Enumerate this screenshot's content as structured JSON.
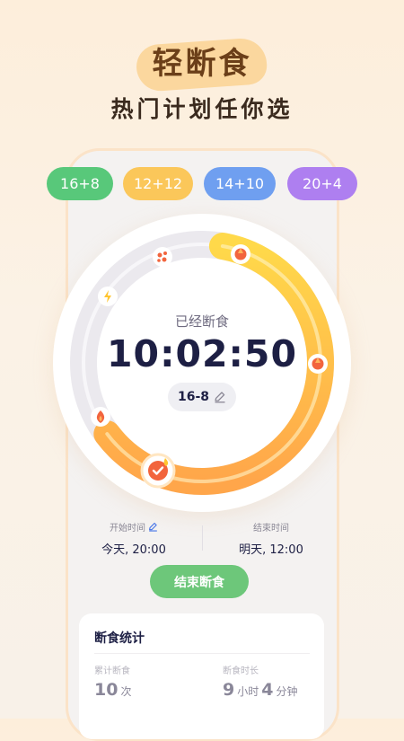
{
  "hero": {
    "title": "轻断食",
    "subtitle": "热门计划任你选"
  },
  "plans": [
    "16+8",
    "12+12",
    "14+10",
    "20+4"
  ],
  "dial": {
    "label": "已经断食",
    "elapsed": "10:02:50",
    "plan": "16-8",
    "progress": 0.62
  },
  "times": {
    "start_label": "开始时间",
    "start_value": "今天, 20:00",
    "end_label": "结束时间",
    "end_value": "明天, 12:00"
  },
  "end_button": "结束断食",
  "stats": {
    "title": "断食统计",
    "total_label": "累计断食",
    "total_value": "10",
    "total_unit": "次",
    "duration_label": "断食时长",
    "duration_hours": "9",
    "duration_hours_unit": "小时",
    "duration_minutes": "4",
    "duration_minutes_unit": "分钟"
  },
  "colors": {
    "accent_green": "#58c87a",
    "accent_yellow": "#fbc75a",
    "accent_blue": "#6f9ff0",
    "accent_purple": "#ae7ff0",
    "progress_orange": "#ffa64a",
    "text_dark": "#1d1f44"
  },
  "icons": [
    "fat-burn-icon",
    "energy-icon",
    "molecule-icon",
    "flame-icon",
    "check-icon",
    "edit-icon"
  ]
}
